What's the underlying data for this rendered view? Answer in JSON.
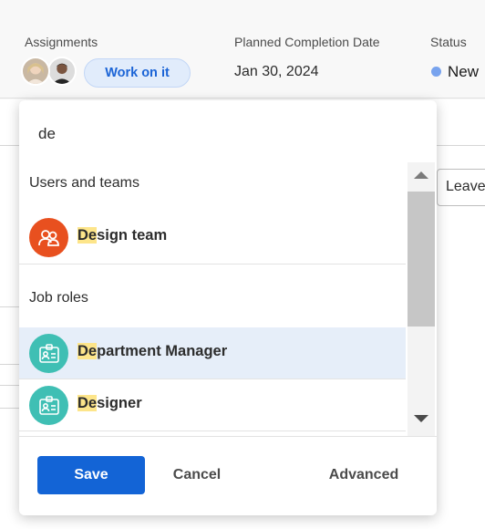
{
  "header": {
    "assignments_label": "Assignments",
    "work_on_it_label": "Work on it",
    "planned_completion_label": "Planned Completion Date",
    "planned_completion_value": "Jan 30, 2024",
    "status_label": "Status",
    "status_value": "New",
    "status_color": "#78a3ee"
  },
  "background": {
    "leave_button_label": "Leave"
  },
  "popover": {
    "search_value": "de",
    "users_section_label": "Users and teams",
    "job_roles_section_label": "Job roles",
    "options": [
      {
        "match": "De",
        "rest": "sign team",
        "icon": "team-icon",
        "color": "#e8501f"
      },
      {
        "match": "De",
        "rest": "partment Manager",
        "icon": "job-role-badge-icon",
        "color": "#3fbfb4",
        "selected": true
      },
      {
        "match": "De",
        "rest": "signer",
        "icon": "job-role-badge-icon",
        "color": "#3fbfb4"
      }
    ],
    "save_label": "Save",
    "cancel_label": "Cancel",
    "advanced_label": "Advanced",
    "accent_color": "#1364d6",
    "highlight_color": "#fde58a"
  }
}
